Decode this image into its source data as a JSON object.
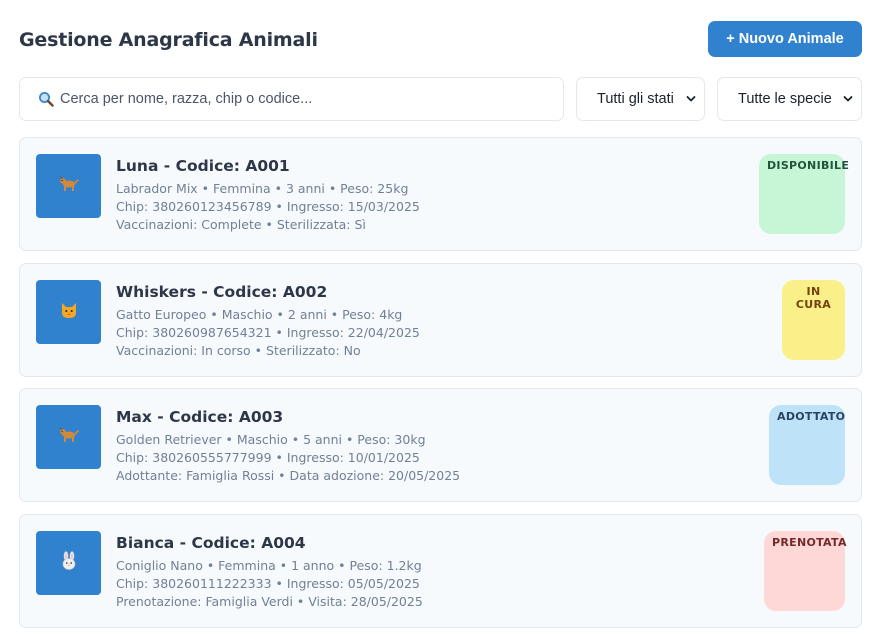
{
  "header": {
    "title": "Gestione Anagrafica Animali",
    "new_button": "+ Nuovo Animale"
  },
  "filters": {
    "search_placeholder": "Cerca per nome, razza, chip o codice...",
    "status_select": "Tutti gli stati",
    "species_select": "Tutte le specie"
  },
  "animals": [
    {
      "icon": "dog-icon",
      "title": "Luna - Codice: A001",
      "line1": "Labrador Mix • Femmina • 3 anni • Peso: 25kg",
      "line2": "Chip: 380260123456789 • Ingresso: 15/03/2025",
      "line3": "Vaccinazioni: Complete • Sterilizzata: Sì",
      "status": "DISPONIBILE"
    },
    {
      "icon": "cat-icon",
      "title": "Whiskers - Codice: A002",
      "line1": "Gatto Europeo • Maschio • 2 anni • Peso: 4kg",
      "line2": "Chip: 380260987654321 • Ingresso: 22/04/2025",
      "line3": "Vaccinazioni: In corso • Sterilizzato: No",
      "status": "IN CURA"
    },
    {
      "icon": "dog-icon",
      "title": "Max - Codice: A003",
      "line1": "Golden Retriever • Maschio • 5 anni • Peso: 30kg",
      "line2": "Chip: 380260555777999 • Ingresso: 10/01/2025",
      "line3": "Adottante: Famiglia Rossi • Data adozione: 20/05/2025",
      "status": "ADOTTATO"
    },
    {
      "icon": "rabbit-icon",
      "title": "Bianca - Codice: A004",
      "line1": "Coniglio Nano • Femmina • 1 anno • Peso: 1.2kg",
      "line2": "Chip: 380260111222333 • Ingresso: 05/05/2025",
      "line3": "Prenotazione: Famiglia Verdi • Visita: 28/05/2025",
      "status": "PRENOTATA"
    }
  ],
  "colors": {
    "accent": "#3182ce",
    "disponibile": "#c6f6d5",
    "in_cura": "#faf089",
    "adottato": "#bee3f8",
    "prenotata": "#fed7d7"
  }
}
